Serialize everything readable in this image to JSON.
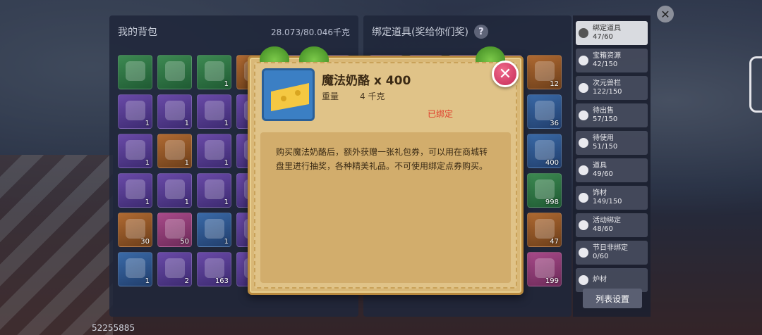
{
  "backpack": {
    "title": "我的背包",
    "weight": "28.073/80.046千克",
    "slots": [
      {
        "quality": "green",
        "count": ""
      },
      {
        "quality": "green",
        "count": ""
      },
      {
        "quality": "green",
        "count": "1"
      },
      {
        "quality": "orange",
        "count": ""
      },
      {
        "quality": "purple",
        "count": ""
      },
      {
        "quality": "purple",
        "count": ""
      },
      {
        "quality": "purple",
        "count": "1"
      },
      {
        "quality": "purple",
        "count": "1"
      },
      {
        "quality": "purple",
        "count": "1"
      },
      {
        "quality": "purple",
        "count": ""
      },
      {
        "quality": "purple",
        "count": ""
      },
      {
        "quality": "purple",
        "count": ""
      },
      {
        "quality": "purple",
        "count": "1"
      },
      {
        "quality": "orange",
        "count": "1"
      },
      {
        "quality": "purple",
        "count": "1"
      },
      {
        "quality": "purple",
        "count": ""
      },
      {
        "quality": "purple",
        "count": ""
      },
      {
        "quality": "purple",
        "count": ""
      },
      {
        "quality": "purple",
        "count": "1"
      },
      {
        "quality": "purple",
        "count": "1"
      },
      {
        "quality": "purple",
        "count": "1"
      },
      {
        "quality": "purple",
        "count": ""
      },
      {
        "quality": "purple",
        "count": ""
      },
      {
        "quality": "purple",
        "count": ""
      },
      {
        "quality": "orange",
        "count": "30"
      },
      {
        "quality": "pink",
        "count": "50"
      },
      {
        "quality": "blue",
        "count": "1"
      },
      {
        "quality": "purple",
        "count": ""
      },
      {
        "quality": "purple",
        "count": ""
      },
      {
        "quality": "purple",
        "count": ""
      },
      {
        "quality": "blue",
        "count": "1"
      },
      {
        "quality": "purple",
        "count": "2"
      },
      {
        "quality": "purple",
        "count": "163"
      },
      {
        "quality": "purple",
        "count": ""
      },
      {
        "quality": "purple",
        "count": ""
      },
      {
        "quality": "purple",
        "count": ""
      }
    ]
  },
  "bound": {
    "title": "绑定道具(奖给你们奖)",
    "help_icon": "?",
    "slots": [
      {
        "quality": "purple",
        "count": ""
      },
      {
        "quality": "purple",
        "count": ""
      },
      {
        "quality": "purple",
        "count": ""
      },
      {
        "quality": "purple",
        "count": ""
      },
      {
        "quality": "orange",
        "count": "12"
      },
      {
        "quality": "purple",
        "count": ""
      },
      {
        "quality": "purple",
        "count": ""
      },
      {
        "quality": "purple",
        "count": ""
      },
      {
        "quality": "purple",
        "count": ""
      },
      {
        "quality": "blue",
        "count": "36"
      },
      {
        "quality": "purple",
        "count": ""
      },
      {
        "quality": "purple",
        "count": ""
      },
      {
        "quality": "purple",
        "count": ""
      },
      {
        "quality": "purple",
        "count": ""
      },
      {
        "quality": "blue",
        "count": "400"
      },
      {
        "quality": "purple",
        "count": ""
      },
      {
        "quality": "purple",
        "count": ""
      },
      {
        "quality": "purple",
        "count": ""
      },
      {
        "quality": "purple",
        "count": ""
      },
      {
        "quality": "green",
        "count": "998"
      },
      {
        "quality": "purple",
        "count": ""
      },
      {
        "quality": "purple",
        "count": ""
      },
      {
        "quality": "purple",
        "count": ""
      },
      {
        "quality": "purple",
        "count": ""
      },
      {
        "quality": "orange",
        "count": "47"
      },
      {
        "quality": "purple",
        "count": ""
      },
      {
        "quality": "purple",
        "count": ""
      },
      {
        "quality": "purple",
        "count": ""
      },
      {
        "quality": "purple",
        "count": ""
      },
      {
        "quality": "pink",
        "count": "199"
      }
    ]
  },
  "tabs": [
    {
      "label": "绑定道具",
      "count": "47/60",
      "active": true
    },
    {
      "label": "宝箱资源",
      "count": "42/150",
      "active": false
    },
    {
      "label": "次元兽栏",
      "count": "122/150",
      "active": false
    },
    {
      "label": "待出售",
      "count": "57/150",
      "active": false
    },
    {
      "label": "待使用",
      "count": "51/150",
      "active": false
    },
    {
      "label": "道具",
      "count": "49/60",
      "active": false
    },
    {
      "label": "饰材",
      "count": "149/150",
      "active": false
    },
    {
      "label": "活动绑定",
      "count": "48/60",
      "active": false
    },
    {
      "label": "节日非绑定",
      "count": "0/60",
      "active": false
    },
    {
      "label": "炉材",
      "count": "",
      "active": false
    }
  ],
  "list_settings_label": "列表设置",
  "close_all_icon": "✕",
  "player_id": "52255885",
  "popup": {
    "item_name": "魔法奶酪 x 400",
    "weight_label": "重量",
    "weight_value": "4 千克",
    "bound_status": "已绑定",
    "description": "购买魔法奶酪后，额外获赠一张礼包券，可以用在商城转盘里进行抽奖，各种精美礼品。不可使用绑定点券购买。",
    "close_icon": "✕"
  },
  "colors": {
    "popup_bg": "#d9b877",
    "bound_red": "#e03a2a",
    "close_pink": "#c42a58"
  }
}
